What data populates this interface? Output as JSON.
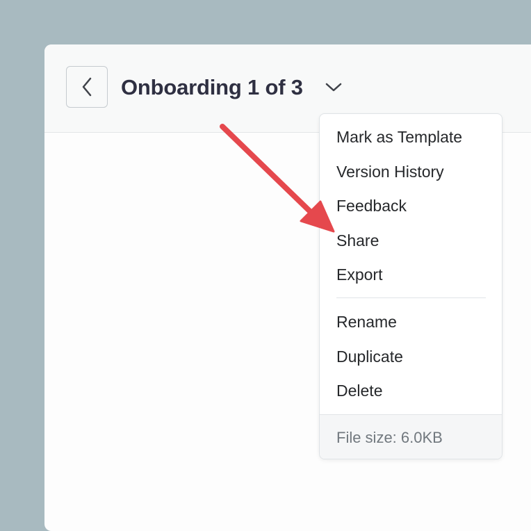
{
  "header": {
    "title": "Onboarding 1 of 3",
    "back_icon": "chevron-left-icon",
    "dropdown_icon": "chevron-down-icon"
  },
  "menu": {
    "items": [
      {
        "label": "Mark as Template"
      },
      {
        "label": "Version History"
      },
      {
        "label": "Feedback"
      },
      {
        "label": "Share"
      },
      {
        "label": "Export"
      },
      {
        "label": "Rename"
      },
      {
        "label": "Duplicate"
      },
      {
        "label": "Delete"
      }
    ],
    "footer": "File size: 6.0KB"
  },
  "annotation": {
    "type": "arrow",
    "color": "#e5484d",
    "points_to": "Share"
  },
  "colors": {
    "background": "#a8bac0",
    "title": "#2f3042",
    "arrow": "#e5484d"
  }
}
